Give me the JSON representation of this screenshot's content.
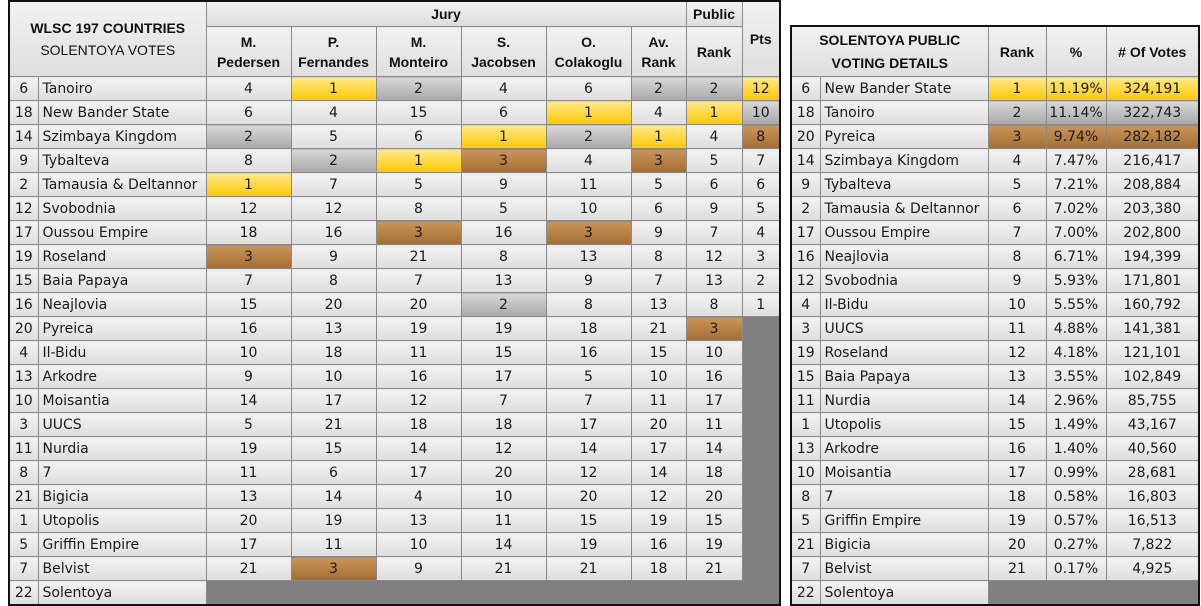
{
  "left_table": {
    "title_line1": "WLSC 197 COUNTRIES",
    "title_line2": "SOLENTOYA VOTES",
    "group_jury": "Jury",
    "group_public": "Public",
    "columns": [
      {
        "line1": "M.",
        "line2": "Pedersen"
      },
      {
        "line1": "P.",
        "line2": "Fernandes"
      },
      {
        "line1": "M.",
        "line2": "Monteiro"
      },
      {
        "line1": "S.",
        "line2": "Jacobsen"
      },
      {
        "line1": "O.",
        "line2": "Colakoglu"
      },
      {
        "line1": "Av.",
        "line2": "Rank"
      },
      {
        "line1": "",
        "line2": "Rank"
      },
      {
        "line1": "",
        "line2": "Pts"
      }
    ],
    "highlight_colors": {
      "gold": "#fcc800",
      "silver": "#a8a8a8",
      "bronze": "#a66d2e",
      "blank": "#808080"
    },
    "rows": [
      {
        "idx": "6",
        "name": "Tanoiro",
        "v": [
          "4",
          "1",
          "2",
          "4",
          "6",
          "2",
          "2",
          "12"
        ],
        "h": [
          "",
          "gold",
          "silver",
          "",
          "",
          "silver",
          "silver",
          "gold"
        ]
      },
      {
        "idx": "18",
        "name": "New Bander State",
        "v": [
          "6",
          "4",
          "15",
          "6",
          "1",
          "4",
          "1",
          "10"
        ],
        "h": [
          "",
          "",
          "",
          "",
          "gold",
          "",
          "gold",
          "silver"
        ]
      },
      {
        "idx": "14",
        "name": "Szimbaya Kingdom",
        "v": [
          "2",
          "5",
          "6",
          "1",
          "2",
          "1",
          "4",
          "8"
        ],
        "h": [
          "silver",
          "",
          "",
          "gold",
          "silver",
          "gold",
          "",
          "bronze"
        ]
      },
      {
        "idx": "9",
        "name": "Tybalteva",
        "v": [
          "8",
          "2",
          "1",
          "3",
          "4",
          "3",
          "5",
          "7"
        ],
        "h": [
          "",
          "silver",
          "gold",
          "bronze",
          "",
          "bronze",
          "",
          ""
        ]
      },
      {
        "idx": "2",
        "name": "Tamausia & Deltannor",
        "v": [
          "1",
          "7",
          "5",
          "9",
          "11",
          "5",
          "6",
          "6"
        ],
        "h": [
          "gold",
          "",
          "",
          "",
          "",
          "",
          "",
          ""
        ]
      },
      {
        "idx": "12",
        "name": "Svobodnia",
        "v": [
          "12",
          "12",
          "8",
          "5",
          "10",
          "6",
          "9",
          "5"
        ],
        "h": [
          "",
          "",
          "",
          "",
          "",
          "",
          "",
          ""
        ]
      },
      {
        "idx": "17",
        "name": "Oussou Empire",
        "v": [
          "18",
          "16",
          "3",
          "16",
          "3",
          "9",
          "7",
          "4"
        ],
        "h": [
          "",
          "",
          "bronze",
          "",
          "bronze",
          "",
          "",
          ""
        ]
      },
      {
        "idx": "19",
        "name": "Roseland",
        "v": [
          "3",
          "9",
          "21",
          "8",
          "13",
          "8",
          "12",
          "3"
        ],
        "h": [
          "bronze",
          "",
          "",
          "",
          "",
          "",
          "",
          ""
        ]
      },
      {
        "idx": "15",
        "name": "Baia Papaya",
        "v": [
          "7",
          "8",
          "7",
          "13",
          "9",
          "7",
          "13",
          "2"
        ],
        "h": [
          "",
          "",
          "",
          "",
          "",
          "",
          "",
          ""
        ]
      },
      {
        "idx": "16",
        "name": "Neajlovia",
        "v": [
          "15",
          "20",
          "20",
          "2",
          "8",
          "13",
          "8",
          "1"
        ],
        "h": [
          "",
          "",
          "",
          "silver",
          "",
          "",
          "",
          ""
        ]
      },
      {
        "idx": "20",
        "name": "Pyreica",
        "v": [
          "16",
          "13",
          "19",
          "19",
          "18",
          "21",
          "3",
          ""
        ],
        "h": [
          "",
          "",
          "",
          "",
          "",
          "",
          "bronze",
          "blank"
        ]
      },
      {
        "idx": "4",
        "name": "Il-Bidu",
        "v": [
          "10",
          "18",
          "11",
          "15",
          "16",
          "15",
          "10",
          ""
        ],
        "h": [
          "",
          "",
          "",
          "",
          "",
          "",
          "",
          "blank"
        ]
      },
      {
        "idx": "13",
        "name": "Arkodre",
        "v": [
          "9",
          "10",
          "16",
          "17",
          "5",
          "10",
          "16",
          ""
        ],
        "h": [
          "",
          "",
          "",
          "",
          "",
          "",
          "",
          "blank"
        ]
      },
      {
        "idx": "10",
        "name": "Moisantia",
        "v": [
          "14",
          "17",
          "12",
          "7",
          "7",
          "11",
          "17",
          ""
        ],
        "h": [
          "",
          "",
          "",
          "",
          "",
          "",
          "",
          "blank"
        ]
      },
      {
        "idx": "3",
        "name": "UUCS",
        "v": [
          "5",
          "21",
          "18",
          "18",
          "17",
          "20",
          "11",
          ""
        ],
        "h": [
          "",
          "",
          "",
          "",
          "",
          "",
          "",
          "blank"
        ]
      },
      {
        "idx": "11",
        "name": "Nurdia",
        "v": [
          "19",
          "15",
          "14",
          "12",
          "14",
          "17",
          "14",
          ""
        ],
        "h": [
          "",
          "",
          "",
          "",
          "",
          "",
          "",
          "blank"
        ]
      },
      {
        "idx": "8",
        "name": "7",
        "v": [
          "11",
          "6",
          "17",
          "20",
          "12",
          "14",
          "18",
          ""
        ],
        "h": [
          "",
          "",
          "",
          "",
          "",
          "",
          "",
          "blank"
        ]
      },
      {
        "idx": "21",
        "name": "Bigicia",
        "v": [
          "13",
          "14",
          "4",
          "10",
          "20",
          "12",
          "20",
          ""
        ],
        "h": [
          "",
          "",
          "",
          "",
          "",
          "",
          "",
          "blank"
        ]
      },
      {
        "idx": "1",
        "name": "Utopolis",
        "v": [
          "20",
          "19",
          "13",
          "11",
          "15",
          "19",
          "15",
          ""
        ],
        "h": [
          "",
          "",
          "",
          "",
          "",
          "",
          "",
          "blank"
        ]
      },
      {
        "idx": "5",
        "name": "Griffin Empire",
        "v": [
          "17",
          "11",
          "10",
          "14",
          "19",
          "16",
          "19",
          ""
        ],
        "h": [
          "",
          "",
          "",
          "",
          "",
          "",
          "",
          "blank"
        ]
      },
      {
        "idx": "7",
        "name": "Belvist",
        "v": [
          "21",
          "3",
          "9",
          "21",
          "21",
          "18",
          "21",
          ""
        ],
        "h": [
          "",
          "bronze",
          "",
          "",
          "",
          "",
          "",
          "blank"
        ]
      },
      {
        "idx": "22",
        "name": "Solentoya",
        "v": [
          "",
          "",
          "",
          "",
          "",
          "",
          "",
          ""
        ],
        "h": [
          "blank",
          "blank",
          "blank",
          "blank",
          "blank",
          "blank",
          "blank",
          "blank"
        ]
      }
    ]
  },
  "right_table": {
    "title_line1": "SOLENTOYA PUBLIC",
    "title_line2": "VOTING DETAILS",
    "col_rank": "Rank",
    "col_pct": "%",
    "col_votes": "# Of Votes",
    "rows": [
      {
        "idx": "6",
        "name": "New Bander State",
        "rank": "1",
        "pct": "11.19%",
        "votes": "324,191",
        "h": "gold"
      },
      {
        "idx": "18",
        "name": "Tanoiro",
        "rank": "2",
        "pct": "11.14%",
        "votes": "322,743",
        "h": "silver"
      },
      {
        "idx": "20",
        "name": "Pyreica",
        "rank": "3",
        "pct": "9.74%",
        "votes": "282,182",
        "h": "bronze"
      },
      {
        "idx": "14",
        "name": "Szimbaya Kingdom",
        "rank": "4",
        "pct": "7.47%",
        "votes": "216,417",
        "h": ""
      },
      {
        "idx": "9",
        "name": "Tybalteva",
        "rank": "5",
        "pct": "7.21%",
        "votes": "208,884",
        "h": ""
      },
      {
        "idx": "2",
        "name": "Tamausia & Deltannor",
        "rank": "6",
        "pct": "7.02%",
        "votes": "203,380",
        "h": ""
      },
      {
        "idx": "17",
        "name": "Oussou Empire",
        "rank": "7",
        "pct": "7.00%",
        "votes": "202,800",
        "h": ""
      },
      {
        "idx": "16",
        "name": "Neajlovia",
        "rank": "8",
        "pct": "6.71%",
        "votes": "194,399",
        "h": ""
      },
      {
        "idx": "12",
        "name": "Svobodnia",
        "rank": "9",
        "pct": "5.93%",
        "votes": "171,801",
        "h": ""
      },
      {
        "idx": "4",
        "name": "Il-Bidu",
        "rank": "10",
        "pct": "5.55%",
        "votes": "160,792",
        "h": ""
      },
      {
        "idx": "3",
        "name": "UUCS",
        "rank": "11",
        "pct": "4.88%",
        "votes": "141,381",
        "h": ""
      },
      {
        "idx": "19",
        "name": "Roseland",
        "rank": "12",
        "pct": "4.18%",
        "votes": "121,101",
        "h": ""
      },
      {
        "idx": "15",
        "name": "Baia Papaya",
        "rank": "13",
        "pct": "3.55%",
        "votes": "102,849",
        "h": ""
      },
      {
        "idx": "11",
        "name": "Nurdia",
        "rank": "14",
        "pct": "2.96%",
        "votes": "85,755",
        "h": ""
      },
      {
        "idx": "1",
        "name": "Utopolis",
        "rank": "15",
        "pct": "1.49%",
        "votes": "43,167",
        "h": ""
      },
      {
        "idx": "13",
        "name": "Arkodre",
        "rank": "16",
        "pct": "1.40%",
        "votes": "40,560",
        "h": ""
      },
      {
        "idx": "10",
        "name": "Moisantia",
        "rank": "17",
        "pct": "0.99%",
        "votes": "28,681",
        "h": ""
      },
      {
        "idx": "8",
        "name": "7",
        "rank": "18",
        "pct": "0.58%",
        "votes": "16,803",
        "h": ""
      },
      {
        "idx": "5",
        "name": "Griffin Empire",
        "rank": "19",
        "pct": "0.57%",
        "votes": "16,513",
        "h": ""
      },
      {
        "idx": "21",
        "name": "Bigicia",
        "rank": "20",
        "pct": "0.27%",
        "votes": "7,822",
        "h": ""
      },
      {
        "idx": "7",
        "name": "Belvist",
        "rank": "21",
        "pct": "0.17%",
        "votes": "4,925",
        "h": ""
      },
      {
        "idx": "22",
        "name": "Solentoya",
        "rank": "",
        "pct": "",
        "votes": "",
        "h": "blank"
      }
    ]
  }
}
